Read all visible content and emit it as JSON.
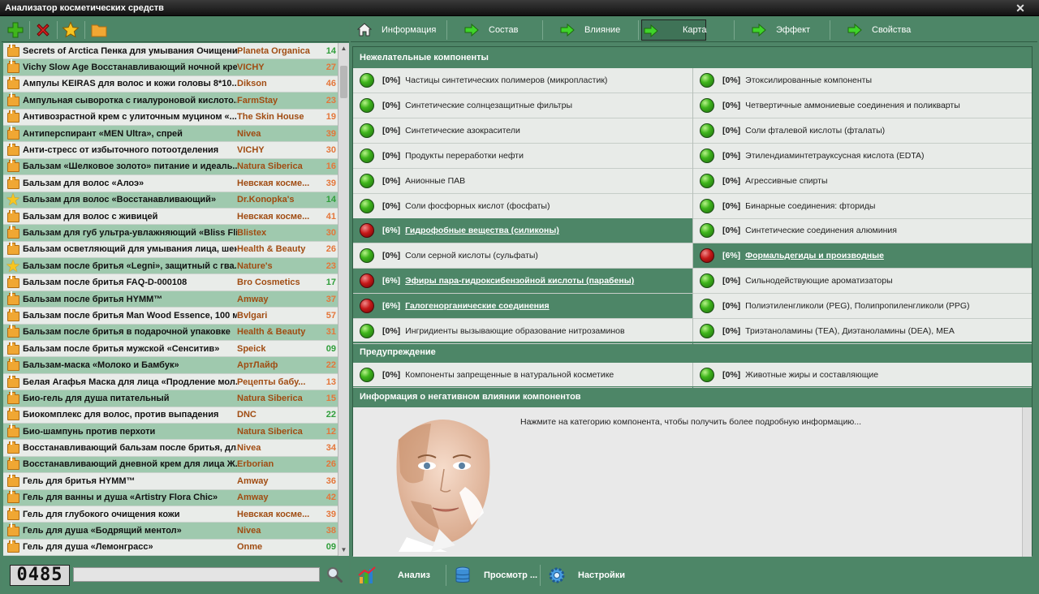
{
  "window": {
    "title": "Анализатор косметических средств"
  },
  "toolbar": {
    "buttons": [
      {
        "name": "add-icon",
        "color": "#3fb51c"
      },
      {
        "name": "delete-icon",
        "color": "#d32020"
      },
      {
        "name": "star-icon",
        "color": "#f7c522"
      },
      {
        "name": "folder-icon",
        "color": "#f0a733"
      }
    ]
  },
  "products": [
    {
      "name": "Secrets of Arctica Пенка для умывания Очищени...",
      "brand": "Planeta Organica",
      "score": "14",
      "color": "g",
      "icon": "folder"
    },
    {
      "name": "Vichy Slow Age Восстанавливающий ночной кре...",
      "brand": "VICHY",
      "score": "27",
      "color": "o",
      "icon": "folder"
    },
    {
      "name": "Ампулы KEIRAS для волос и кожи головы 8*10...",
      "brand": "Dikson",
      "score": "46",
      "color": "o",
      "icon": "folder"
    },
    {
      "name": "Ампульная сыворотка с гиалуроновой кислото...",
      "brand": "FarmStay",
      "score": "23",
      "color": "o",
      "icon": "folder"
    },
    {
      "name": "Антивозрастной крем с улиточным муцином «...",
      "brand": "The Skin House",
      "score": "19",
      "color": "o",
      "icon": "folder"
    },
    {
      "name": "Антиперспирант «MEN Ultra», спрей",
      "brand": "Nivea",
      "score": "39",
      "color": "o",
      "icon": "folder"
    },
    {
      "name": "Анти-стресс от избыточного потоотделения",
      "brand": "VICHY",
      "score": "30",
      "color": "o",
      "icon": "folder"
    },
    {
      "name": "Бальзам «Шелковое золото» питание и идеаль...",
      "brand": "Natura Siberica",
      "score": "16",
      "color": "o",
      "icon": "folder"
    },
    {
      "name": "Бальзам для волос «Алоэ»",
      "brand": "Невская косме...",
      "score": "39",
      "color": "o",
      "icon": "folder"
    },
    {
      "name": "Бальзам для волос «Восстанавливающий»",
      "brand": "Dr.Konopka's",
      "score": "14",
      "color": "g",
      "icon": "star"
    },
    {
      "name": "Бальзам для волос с живицей",
      "brand": "Невская косме...",
      "score": "41",
      "color": "o",
      "icon": "folder"
    },
    {
      "name": "Бальзам для губ ультра-увлажняющий «Bliss Fli...",
      "brand": "Blistex",
      "score": "30",
      "color": "o",
      "icon": "folder"
    },
    {
      "name": "Бальзам осветляющий для умывания лица, шен...",
      "brand": "Health & Beauty",
      "score": "26",
      "color": "o",
      "icon": "folder"
    },
    {
      "name": "Бальзам после бритья «Legni», защитный с гва...",
      "brand": "Nature's",
      "score": "23",
      "color": "o",
      "icon": "star"
    },
    {
      "name": "Бальзам после бритья FAQ-D-000108",
      "brand": "Bro Cosmetics",
      "score": "17",
      "color": "g",
      "icon": "folder"
    },
    {
      "name": "Бальзам после бритья HYMM™",
      "brand": "Amway",
      "score": "37",
      "color": "o",
      "icon": "folder"
    },
    {
      "name": "Бальзам после бритья Man Wood Essence, 100 мл",
      "brand": "Bvlgari",
      "score": "57",
      "color": "o",
      "icon": "folder"
    },
    {
      "name": "Бальзам после бритья в подарочной упаковке",
      "brand": "Health & Beauty",
      "score": "31",
      "color": "o",
      "icon": "folder"
    },
    {
      "name": "Бальзам после бритья мужской «Сенситив»",
      "brand": "Speick",
      "score": "09",
      "color": "g",
      "icon": "folder"
    },
    {
      "name": "Бальзам-маска «Молоко и Бамбук»",
      "brand": "АртЛайф",
      "score": "22",
      "color": "o",
      "icon": "folder"
    },
    {
      "name": "Белая Агафья Маска для лица «Продление мол...",
      "brand": "Рецепты бабу...",
      "score": "13",
      "color": "o",
      "icon": "folder"
    },
    {
      "name": "Био-гель для душа питательный",
      "brand": "Natura Siberica",
      "score": "15",
      "color": "o",
      "icon": "folder"
    },
    {
      "name": "Биокомплекс для волос, против выпадения",
      "brand": "DNC",
      "score": "22",
      "color": "g",
      "icon": "folder"
    },
    {
      "name": "Био-шампунь против перхоти",
      "brand": "Natura Siberica",
      "score": "12",
      "color": "o",
      "icon": "folder"
    },
    {
      "name": "Восстанавливающий бальзам после бритья, дл...",
      "brand": "Nivea",
      "score": "34",
      "color": "o",
      "icon": "folder"
    },
    {
      "name": "Восстанавливающий дневной крем для лица Ж...",
      "brand": "Erborian",
      "score": "26",
      "color": "o",
      "icon": "folder"
    },
    {
      "name": "Гель для бритья HYMM™",
      "brand": "Amway",
      "score": "36",
      "color": "o",
      "icon": "folder"
    },
    {
      "name": "Гель для ванны и душа «Artistry Flora Chic»",
      "brand": "Amway",
      "score": "42",
      "color": "o",
      "icon": "folder"
    },
    {
      "name": "Гель для глубокого очищения кожи",
      "brand": "Невская косме...",
      "score": "39",
      "color": "o",
      "icon": "folder"
    },
    {
      "name": "Гель для душа «Бодрящий ментол»",
      "brand": "Nivea",
      "score": "38",
      "color": "o",
      "icon": "folder"
    },
    {
      "name": "Гель для душа «Лемонграсс»",
      "brand": "Onme",
      "score": "09",
      "color": "g",
      "icon": "folder"
    }
  ],
  "counter": {
    "value": "0485"
  },
  "search": {
    "value": ""
  },
  "tabs": [
    {
      "label": "Информация",
      "icon": "home-icon",
      "active": false
    },
    {
      "label": "Состав",
      "icon": "arrow-right-icon",
      "active": false
    },
    {
      "label": "Влияние",
      "icon": "arrow-right-icon",
      "active": false
    },
    {
      "label": "Карта",
      "icon": "arrow-right-icon",
      "active": true
    },
    {
      "label": "Эффект",
      "icon": "arrow-right-icon",
      "active": false
    },
    {
      "label": "Свойства",
      "icon": "arrow-right-icon",
      "active": false
    }
  ],
  "undesirable": {
    "title": "Нежелательные компоненты",
    "left": [
      {
        "pct": "[0%]",
        "text": "Частицы синтетических полимеров (микропластик)",
        "status": "ok"
      },
      {
        "pct": "[0%]",
        "text": "Синтетические солнцезащитные фильтры",
        "status": "ok"
      },
      {
        "pct": "[0%]",
        "text": "Синтетические азокрасители",
        "status": "ok"
      },
      {
        "pct": "[0%]",
        "text": "Продукты переработки нефти",
        "status": "ok"
      },
      {
        "pct": "[0%]",
        "text": "Анионные ПАВ",
        "status": "ok"
      },
      {
        "pct": "[0%]",
        "text": "Соли фосфорных кислот (фосфаты)",
        "status": "ok"
      },
      {
        "pct": "[6%]",
        "text": "Гидрофобные вещества (силиконы)",
        "status": "bad"
      },
      {
        "pct": "[0%]",
        "text": "Соли серной кислоты (сульфаты)",
        "status": "ok"
      },
      {
        "pct": "[6%]",
        "text": "Эфиры пара-гидроксибензойной кислоты (парабены)",
        "status": "bad"
      },
      {
        "pct": "[6%]",
        "text": "Галогенорганические соединения",
        "status": "bad"
      },
      {
        "pct": "[0%]",
        "text": "Ингридиенты вызывающие образование нитрозаминов",
        "status": "ok"
      }
    ],
    "right": [
      {
        "pct": "[0%]",
        "text": "Этоксилированные компоненты",
        "status": "ok"
      },
      {
        "pct": "[0%]",
        "text": "Четвертичные аммониевые соединения и поликварты",
        "status": "ok"
      },
      {
        "pct": "[0%]",
        "text": "Соли фталевой кислоты (фталаты)",
        "status": "ok"
      },
      {
        "pct": "[0%]",
        "text": "Этилендиаминтетрауксусная кислота (EDTA)",
        "status": "ok"
      },
      {
        "pct": "[0%]",
        "text": "Агрессивные спирты",
        "status": "ok"
      },
      {
        "pct": "[0%]",
        "text": "Бинарные соединения: фториды",
        "status": "ok"
      },
      {
        "pct": "[0%]",
        "text": "Синтетические соединения алюминия",
        "status": "ok"
      },
      {
        "pct": "[6%]",
        "text": "Формальдегиды и производные",
        "status": "bad"
      },
      {
        "pct": "[0%]",
        "text": "Сильнодействующие ароматизаторы",
        "status": "ok"
      },
      {
        "pct": "[0%]",
        "text": "Полиэтиленгликоли (PEG), Полипропиленгликоли (PPG)",
        "status": "ok"
      },
      {
        "pct": "[0%]",
        "text": "Триэтаноламины (TEA), Диэтаноламины (DEA), MEA",
        "status": "ok"
      }
    ]
  },
  "warning": {
    "title": "Предупреждение",
    "left": {
      "pct": "[0%]",
      "text": "Компоненты запрещенные в натуральной косметике",
      "status": "ok"
    },
    "right": {
      "pct": "[0%]",
      "text": "Животные жиры и составляющие",
      "status": "ok"
    }
  },
  "info": {
    "title": "Информация о негативном влиянии компонентов",
    "text": "Нажмите на категорию компонента, чтобы получить более подробную информацию..."
  },
  "bottom_buttons": [
    {
      "label": "Анализ",
      "icon": "chart-icon"
    },
    {
      "label": "Просмотр ...",
      "icon": "database-icon"
    },
    {
      "label": "Настройки",
      "icon": "settings-icon"
    }
  ]
}
